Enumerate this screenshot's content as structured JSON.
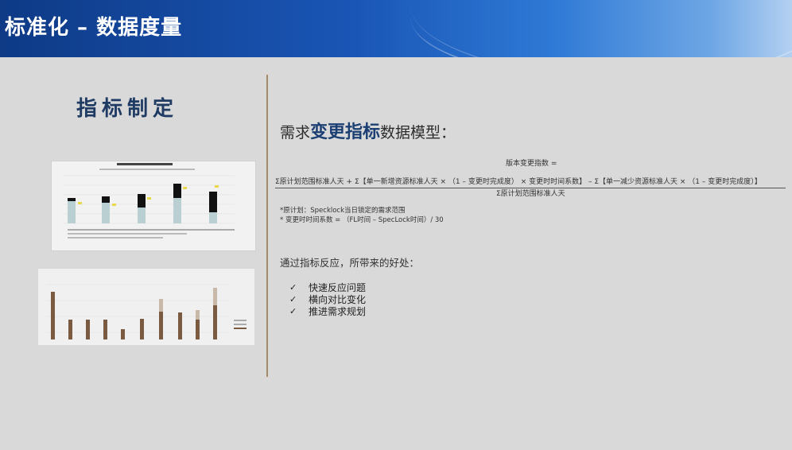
{
  "header": {
    "title": "标准化 – 数据度量"
  },
  "left": {
    "title": "指标制定"
  },
  "right": {
    "heading_prefix": "需求",
    "heading_em": "变更指标",
    "heading_suffix": "数据模型：",
    "formula_title": "版本变更指数 =",
    "formula_numerator": "Σ原计划范围标准人天 + Σ【单一新增资源标准人天 × （1 – 变更时完成度） × 变更时时间系数】 – Σ【单一减少资源标准人天 × （1 – 变更时完成度）】",
    "formula_denominator": "Σ原计划范围标准人天",
    "note1": "*原计划：Specklock当日锁定的需求范围",
    "note2": "* 变更时时间系数 = （FL时间 – SpecLock时间）/ 30",
    "benefit_title": "通过指标反应，所带来的好处：",
    "benefits": [
      {
        "check": "✓",
        "label": "快速反应问题"
      },
      {
        "check": "✓",
        "label": "横向对比变化"
      },
      {
        "check": "✓",
        "label": "推进需求规划"
      }
    ]
  },
  "colors": {
    "header_dark": "#0e3a86",
    "accent": "#1c3f73",
    "divider": "#a58a6a",
    "bar_brown": "#7a5a40",
    "bar_teal": "#b9cfd2"
  }
}
